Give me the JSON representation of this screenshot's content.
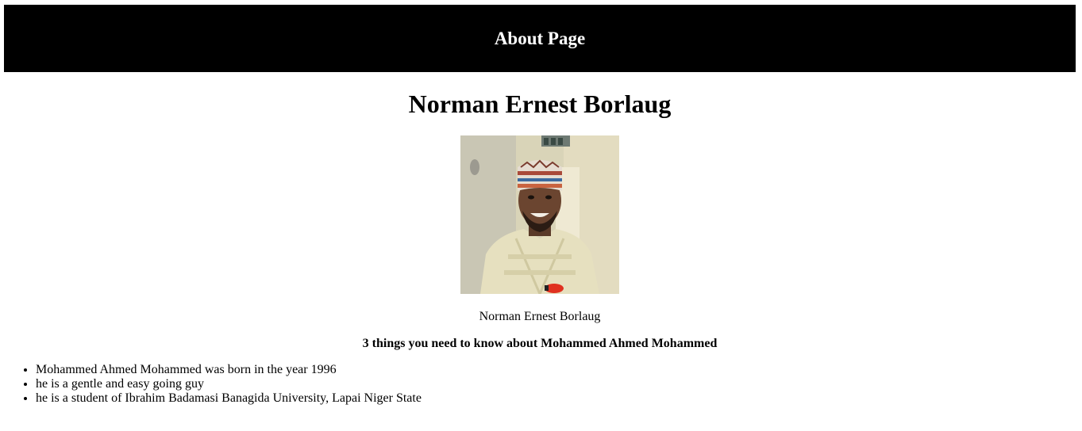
{
  "header": {
    "title": "About Page",
    "background": "#000000",
    "text_color": "#ffffff"
  },
  "profile": {
    "name": "Norman Ernest Borlaug",
    "image_caption": "Norman Ernest Borlaug",
    "image_alt": "portrait photo of a smiling man in a patterned cap and cream kaftan"
  },
  "facts": {
    "heading": "3 things you need to know about Mohammed Ahmed Mohammed",
    "items": [
      "Mohammed Ahmed Mohammed was born in the year 1996",
      "he is a gentle and easy going guy",
      "he is a student of Ibrahim Badamasi Banagida University, Lapai Niger State"
    ]
  }
}
